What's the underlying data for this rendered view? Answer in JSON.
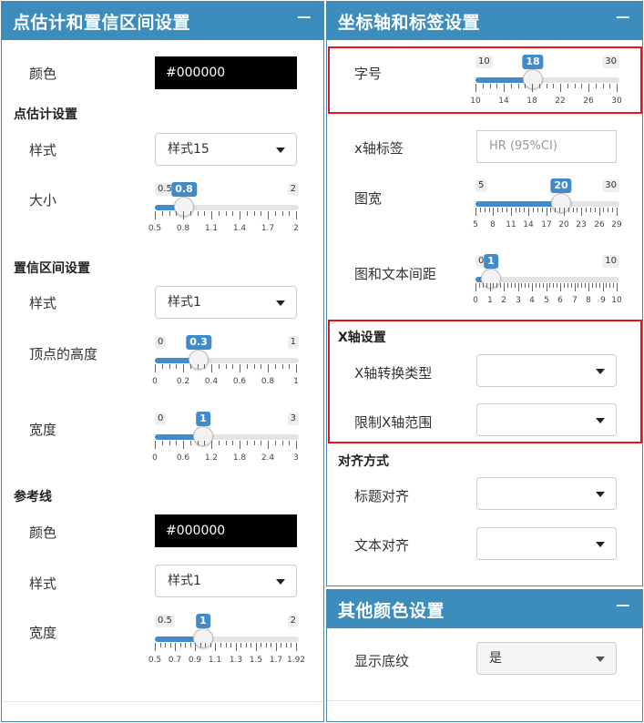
{
  "left": {
    "title": "点估计和置信区间设置",
    "collapse": "−",
    "ci_color_label": "颜色",
    "ci_color_value": "#000000",
    "point_section": "点估计设置",
    "point_style_label": "样式",
    "point_style_value": "样式15",
    "point_size_label": "大小",
    "point_size_slider": {
      "min": "0.5",
      "max": "2",
      "value": "0.8",
      "fraction": 0.2,
      "ticks": [
        "0.5",
        "0.8",
        "1.1",
        "1.4",
        "1.7",
        "2"
      ]
    },
    "ci_section": "置信区间设置",
    "ci_style_label": "样式",
    "ci_style_value": "样式1",
    "ci_height_label": "顶点的高度",
    "ci_height_slider": {
      "min": "0",
      "max": "1",
      "value": "0.3",
      "fraction": 0.3,
      "ticks": [
        "0",
        "0.2",
        "0.4",
        "0.6",
        "0.8",
        "1"
      ]
    },
    "ci_width_label": "宽度",
    "ci_width_slider": {
      "min": "0",
      "max": "3",
      "value": "1",
      "fraction": 0.333,
      "ticks": [
        "0",
        "0.6",
        "1.2",
        "1.8",
        "2.4",
        "3"
      ]
    },
    "ref_section": "参考线",
    "ref_color_label": "颜色",
    "ref_color_value": "#000000",
    "ref_style_label": "样式",
    "ref_style_value": "样式1",
    "ref_width_label": "宽度",
    "ref_width_slider": {
      "min": "0.5",
      "max": "2",
      "value": "1",
      "fraction": 0.333,
      "ticks": [
        "0.5",
        "0.7",
        "0.9",
        "1.1",
        "1.3",
        "1.5",
        "1.7",
        "1.92"
      ]
    }
  },
  "right": {
    "title": "坐标轴和标签设置",
    "collapse": "−",
    "font_size_label": "字号",
    "font_size_slider": {
      "min": "10",
      "max": "30",
      "value": "18",
      "fraction": 0.4,
      "ticks": [
        "10",
        "14",
        "18",
        "22",
        "26",
        "30"
      ]
    },
    "xlabel_label": "x轴标签",
    "xlabel_placeholder": "HR (95%CI)",
    "fig_width_label": "图宽",
    "fig_width_slider": {
      "min": "5",
      "max": "30",
      "value": "20",
      "fraction": 0.6,
      "ticks": [
        "5",
        "8",
        "11",
        "14",
        "17",
        "20",
        "23",
        "26",
        "29"
      ]
    },
    "gap_label": "图和文本间距",
    "gap_slider": {
      "min": "0",
      "max": "10",
      "value": "1",
      "fraction": 0.1,
      "ticks": [
        "0",
        "1",
        "2",
        "3",
        "4",
        "5",
        "6",
        "7",
        "8",
        "9",
        "10"
      ]
    },
    "xaxis_section": "X轴设置",
    "xtrans_label": "X轴转换类型",
    "xtrans_value": "",
    "xlim_label": "限制X轴范围",
    "xlim_value": "",
    "align_section": "对齐方式",
    "title_align_label": "标题对齐",
    "title_align_value": "",
    "text_align_label": "文本对齐",
    "text_align_value": ""
  },
  "other": {
    "title": "其他颜色设置",
    "collapse": "−",
    "shade_label": "显示底纹",
    "shade_value": "是"
  }
}
